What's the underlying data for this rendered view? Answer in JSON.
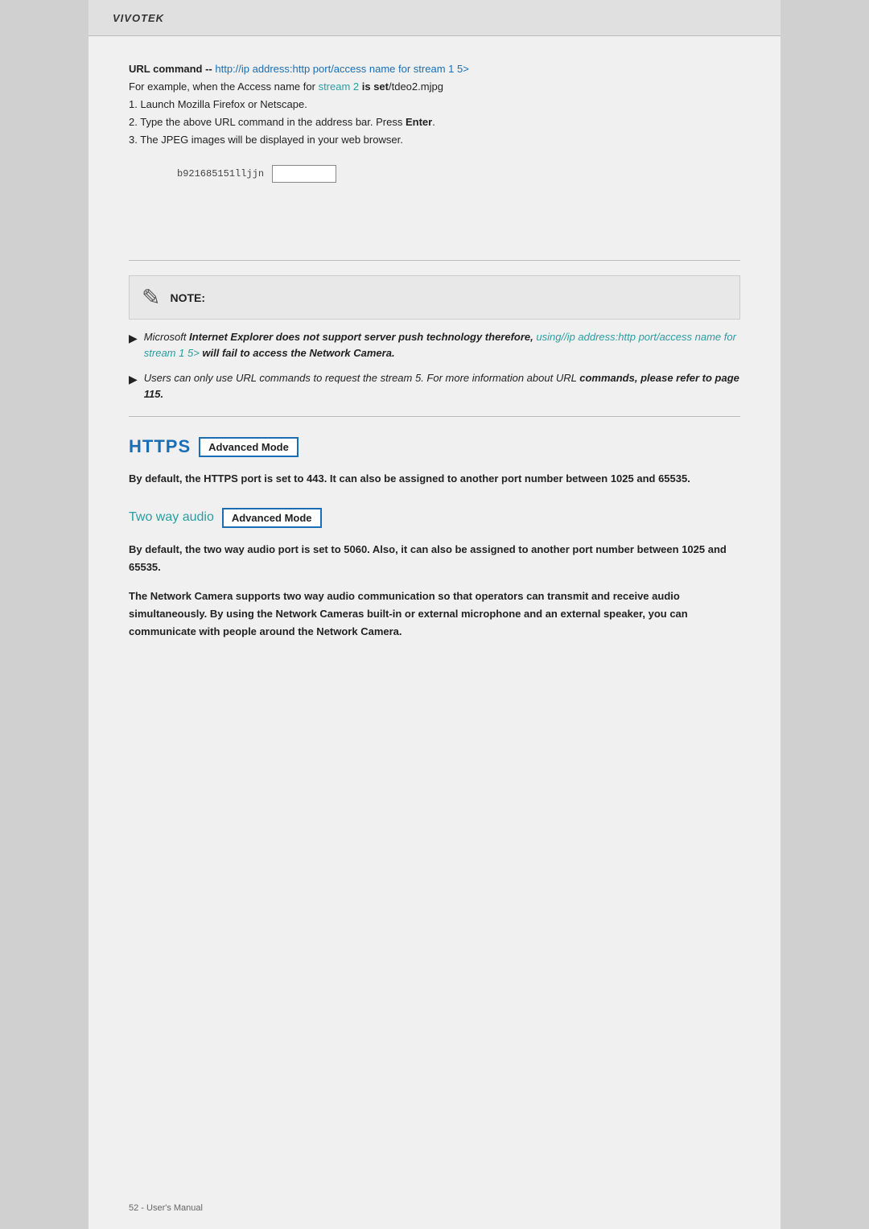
{
  "header": {
    "logo": "VIVOTEK"
  },
  "url_command": {
    "line1_prefix": "URL command -- ",
    "line1_link": "http://ip address:http port/access name for stream 1  5>",
    "line2_prefix": "For example, when the Access name for ",
    "line2_stream": "stream 2",
    "line2_suffix": " is set/tdeo2.mjpg",
    "line3": "1. Launch Mozilla Firefox or Netscape.",
    "line4_prefix": "2. Type the above URL command in the address bar. Press ",
    "line4_bold": "Enter",
    "line4_suffix": ".",
    "line5": "3. The JPEG images will be displayed in your web browser.",
    "input_label": "b921685151lljjn",
    "input_placeholder": ""
  },
  "note": {
    "title": "NOTE:",
    "item1_prefix": "Microsoft  ",
    "item1_bold": "Internet Explorer does not support server push technology therefore, ",
    "item1_link": "using//ip address:http port/access name for stream 1  5>",
    "item1_suffix": "    will fail to access the Network Camera.",
    "item2_prefix": "Users can only use URL commands to request the stream 5. For more information about URL ",
    "item2_bold": "commands, please refer to page 115."
  },
  "https_section": {
    "title": "HTTPS",
    "advanced_mode_label": "Advanced Mode",
    "description": "By default, the HTTPS port is set to 443. It can also be assigned to another port number between 1025 and 65535."
  },
  "two_way_audio": {
    "title": "Two way audio",
    "advanced_mode_label": "Advanced Mode",
    "desc1": "By default, the two way audio port is set to 5060. Also, it can also be assigned to another port number between 1025 and 65535.",
    "desc2": "The Network Camera supports two way audio communication so that operators can transmit and receive audio simultaneously. By using the Network Cameras built-in or external microphone and an external speaker, you can communicate with people around the Network Camera."
  },
  "footer": {
    "text": "52 - User's Manual"
  }
}
